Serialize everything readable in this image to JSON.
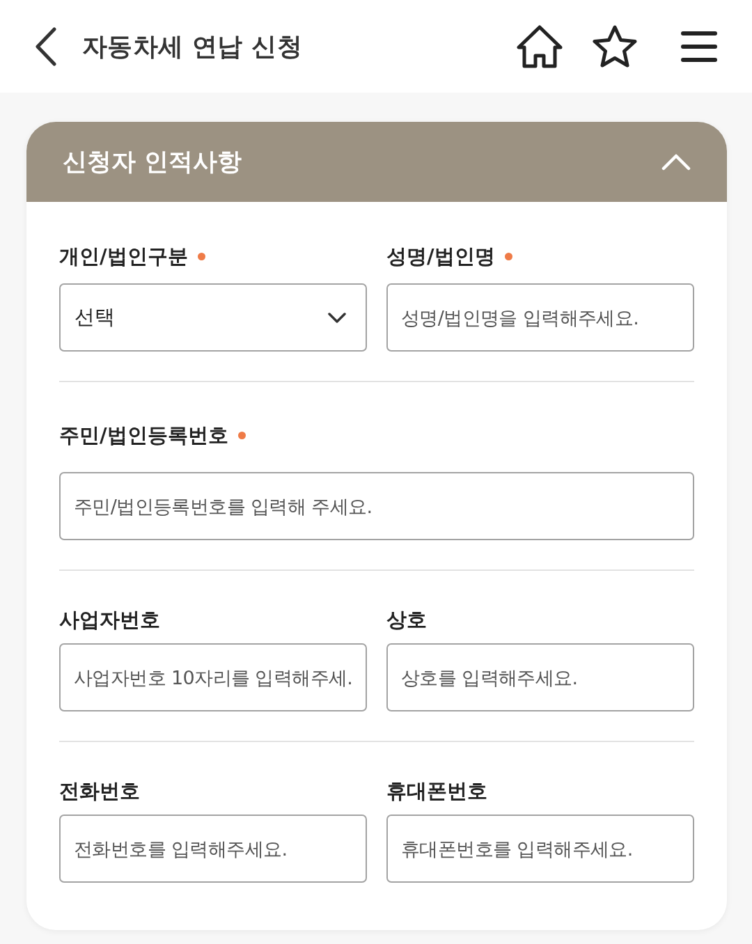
{
  "header": {
    "title": "자동차세 연납 신청"
  },
  "section": {
    "title": "신청자 인적사항",
    "expanded": true,
    "rows": [
      {
        "fields": [
          {
            "kind": "select",
            "label": "개인/법인구분",
            "required": true,
            "value": "선택"
          },
          {
            "kind": "input",
            "label": "성명/법인명",
            "required": true,
            "placeholder": "성명/법인명을 입력해주세요."
          }
        ]
      },
      {
        "fields": [
          {
            "kind": "input",
            "label": "주민/법인등록번호",
            "required": true,
            "placeholder": "주민/법인등록번호를 입력해 주세요."
          }
        ]
      },
      {
        "fields": [
          {
            "kind": "input",
            "label": "사업자번호",
            "required": false,
            "placeholder": "사업자번호 10자리를 입력해주세."
          },
          {
            "kind": "input",
            "label": "상호",
            "required": false,
            "placeholder": "상호를 입력해주세요."
          }
        ]
      },
      {
        "fields": [
          {
            "kind": "input",
            "label": "전화번호",
            "required": false,
            "placeholder": "전화번호를 입력해주세요."
          },
          {
            "kind": "input",
            "label": "휴대폰번호",
            "required": false,
            "placeholder": "휴대폰번호를 입력해주세요."
          }
        ]
      }
    ]
  }
}
